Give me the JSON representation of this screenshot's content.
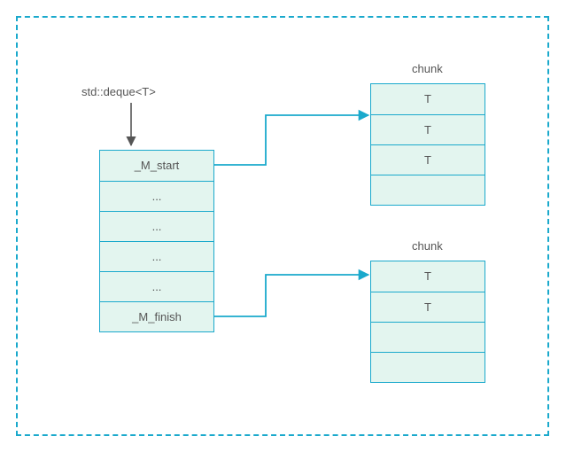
{
  "title": "std::deque<T>",
  "deque_cells": [
    "_M_start",
    "...",
    "...",
    "...",
    "...",
    "_M_finish"
  ],
  "chunk_label": "chunk",
  "chunk1_cells": [
    "T",
    "T",
    "T",
    ""
  ],
  "chunk2_cells": [
    "T",
    "T",
    "",
    ""
  ],
  "colors": {
    "border": "#1aa9cc",
    "fill": "#e3f5ef",
    "arrow": "#1aa9cc",
    "text": "#555"
  }
}
